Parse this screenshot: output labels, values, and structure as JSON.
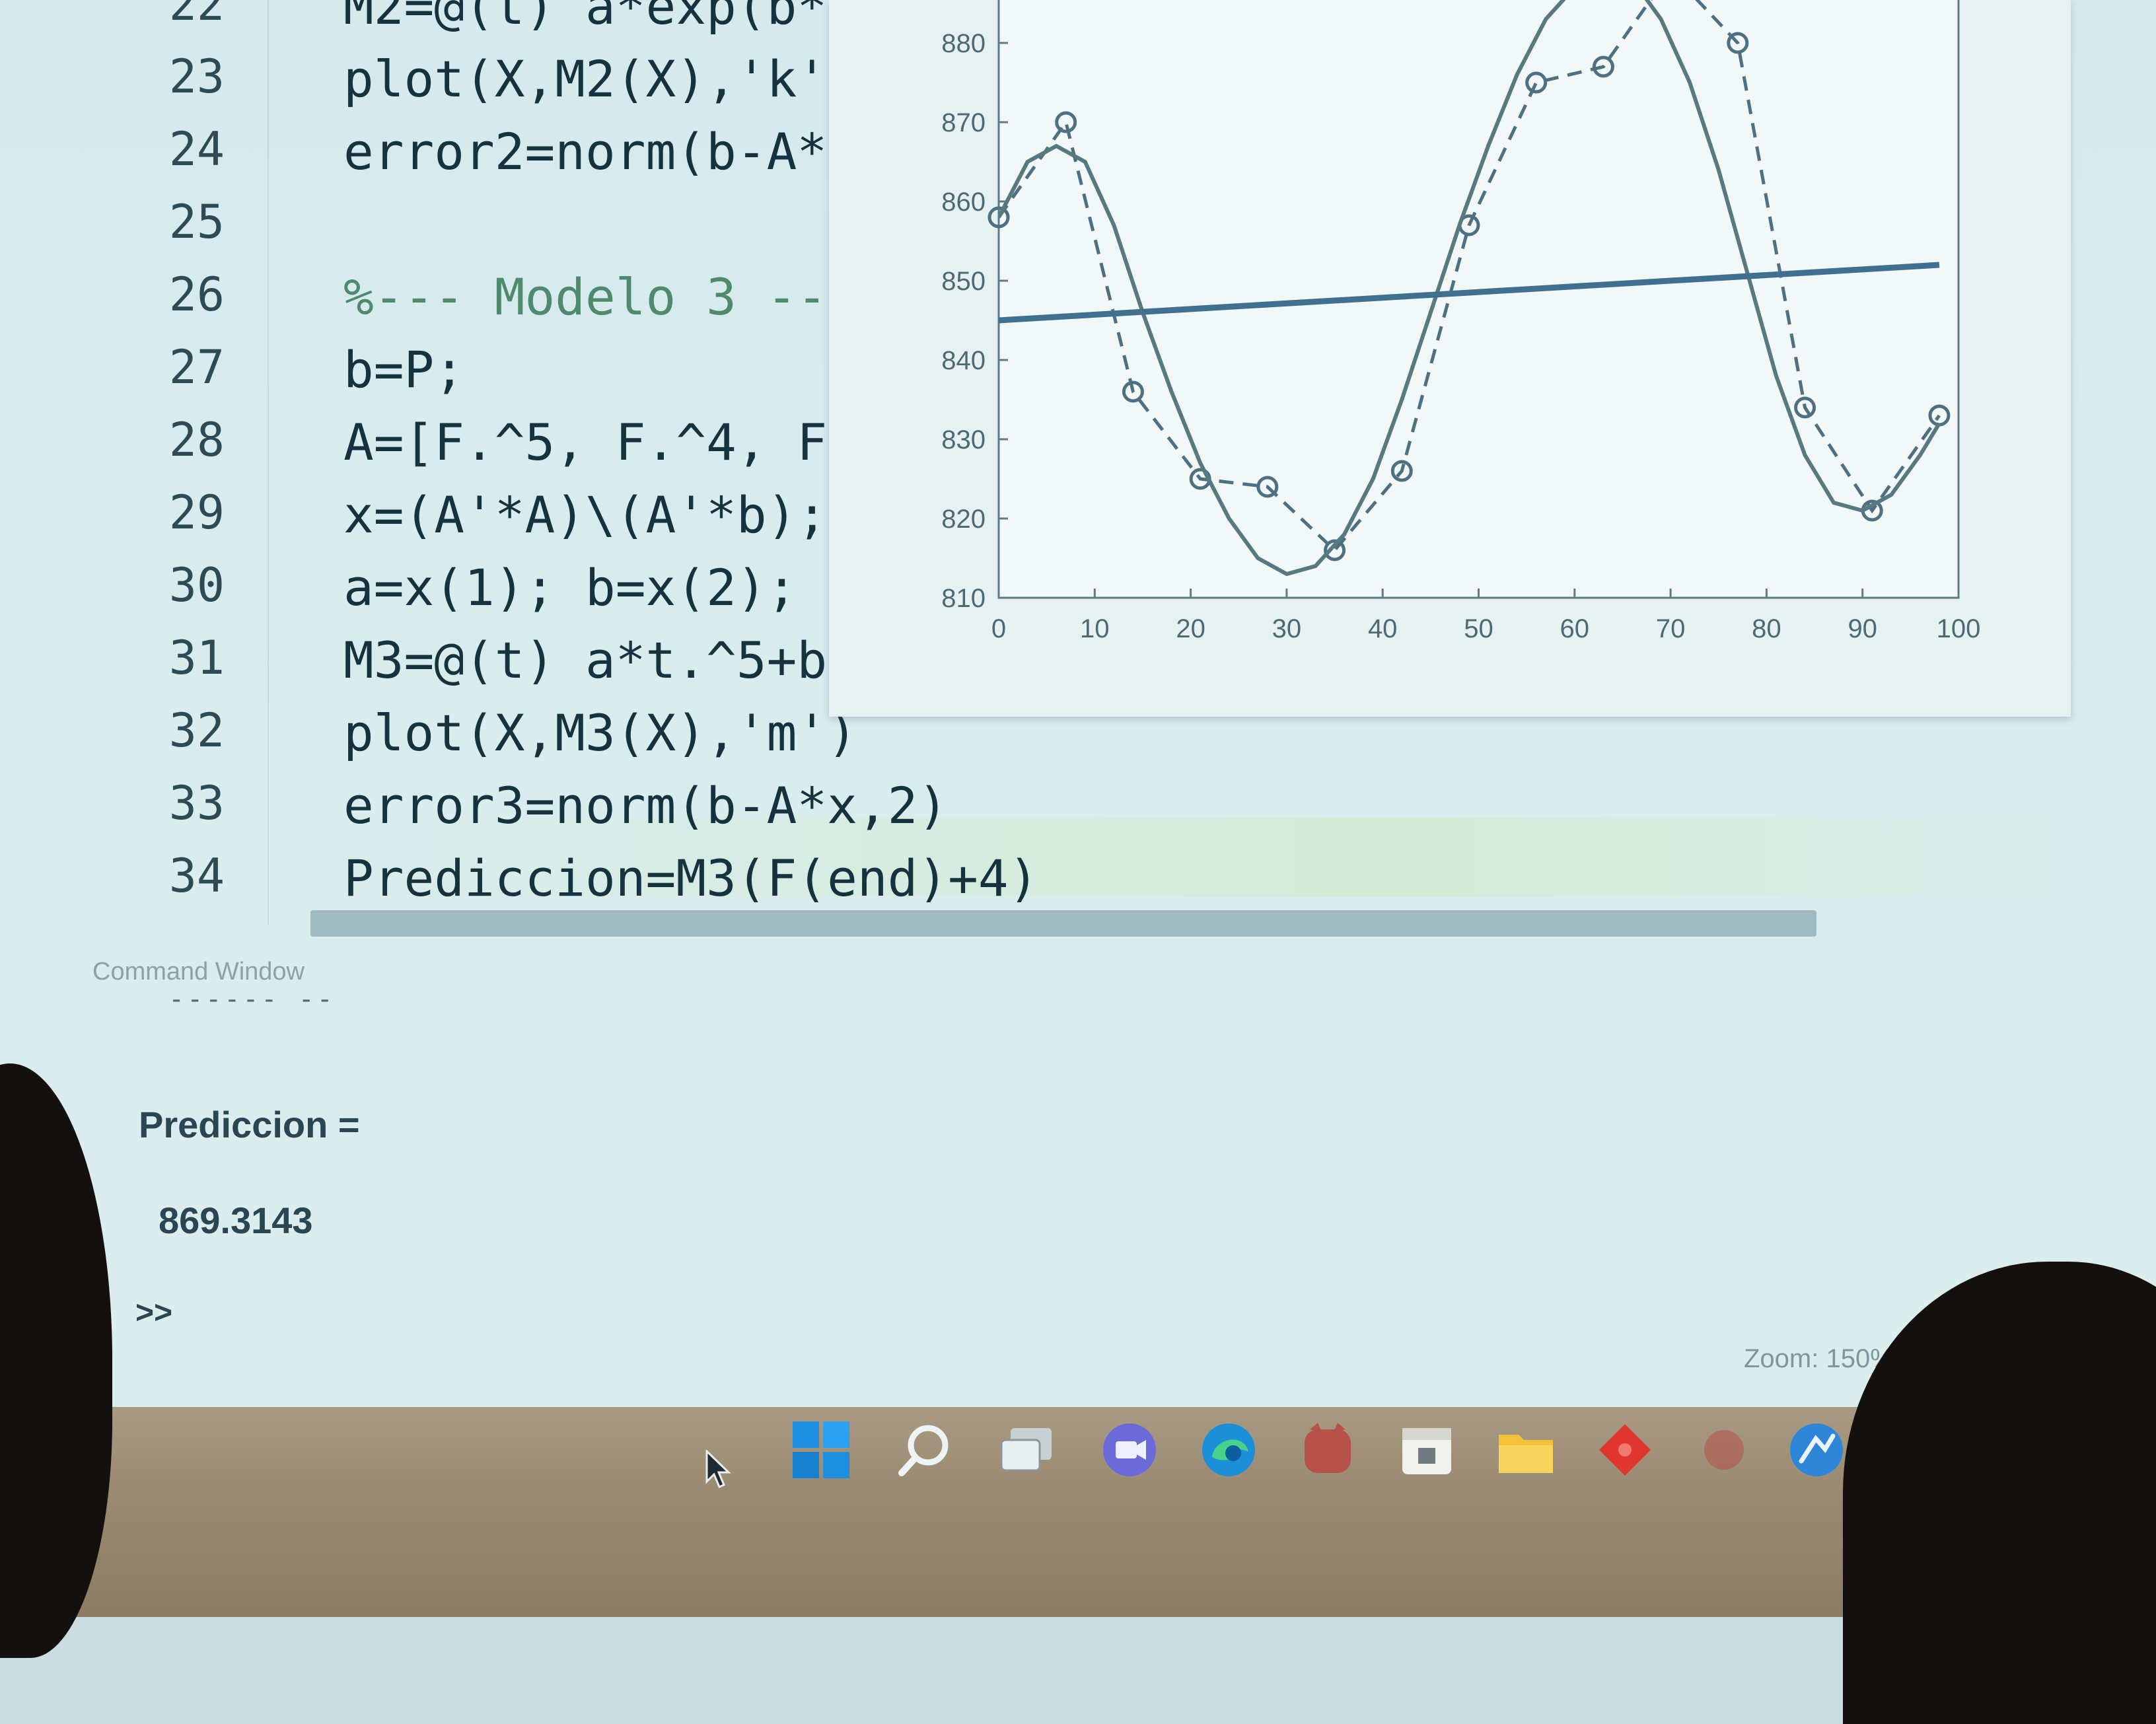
{
  "editor": {
    "lines": [
      {
        "num": "22",
        "text": "M2=@(t) a*exp(b*",
        "type": "code"
      },
      {
        "num": "23",
        "text": "plot(X,M2(X),'k'",
        "type": "code"
      },
      {
        "num": "24",
        "text": "error2=norm(b-A*",
        "type": "code"
      },
      {
        "num": "25",
        "text": "",
        "type": "code"
      },
      {
        "num": "26",
        "text": "%--- Modelo 3 --",
        "type": "comment"
      },
      {
        "num": "27",
        "text": "b=P;",
        "type": "code"
      },
      {
        "num": "28",
        "text": "A=[F.^5, F.^4, F",
        "type": "code"
      },
      {
        "num": "29",
        "text": "x=(A'*A)\\(A'*b);",
        "type": "code"
      },
      {
        "num": "30",
        "text": "a=x(1); b=x(2);",
        "type": "code"
      },
      {
        "num": "31",
        "text": "M3=@(t) a*t.^5+b",
        "type": "code"
      },
      {
        "num": "32",
        "text": "plot(X,M3(X),'m')",
        "type": "code"
      },
      {
        "num": "33",
        "text": "error3=norm(b-A*x,2)",
        "type": "code"
      },
      {
        "num": "34",
        "text": "Prediccion=M3(F(end)+4)",
        "type": "code"
      }
    ]
  },
  "command_window": {
    "label": "Command Window",
    "partial_output": "------ --",
    "variable": "Prediccion =",
    "value": "869.3143",
    "prompt": ">>"
  },
  "status": {
    "zoom": "Zoom: 150%"
  },
  "taskbar": {
    "icons": [
      "windows-start-icon",
      "search-icon",
      "task-view-icon",
      "teams-chat-icon",
      "edge-browser-icon",
      "app-icon",
      "calendar-icon",
      "file-explorer-icon",
      "red-app-icon",
      "red-app-icon-2",
      "matlab-icon"
    ]
  },
  "chart_data": {
    "type": "line",
    "xlim": [
      0,
      100
    ],
    "ylim": [
      810,
      880
    ],
    "xticks": [
      0,
      10,
      20,
      30,
      40,
      50,
      60,
      70,
      80,
      90,
      100
    ],
    "yticks": [
      810,
      820,
      830,
      840,
      850,
      860,
      870,
      880
    ],
    "grid": false,
    "series": [
      {
        "style": "dashed-with-circles",
        "color": "#4f7080",
        "x": [
          0,
          7,
          14,
          21,
          28,
          35,
          42,
          49,
          56,
          63,
          70,
          77,
          84,
          91,
          98
        ],
        "y": [
          858,
          870,
          836,
          825,
          824,
          816,
          826,
          857,
          875,
          877,
          889,
          880,
          834,
          821,
          833
        ]
      },
      {
        "style": "solid",
        "color": "#58797f",
        "x": [
          0,
          3,
          6,
          9,
          12,
          15,
          18,
          21,
          24,
          27,
          30,
          33,
          36,
          39,
          42,
          45,
          48,
          51,
          54,
          57,
          60,
          63,
          66,
          69,
          72,
          75,
          78,
          81,
          84,
          87,
          90,
          93,
          96,
          98
        ],
        "y": [
          858,
          865,
          867,
          865,
          857,
          846,
          836,
          827,
          820,
          815,
          813,
          814,
          818,
          825,
          835,
          846,
          857,
          867,
          876,
          883,
          887,
          889,
          888,
          883,
          875,
          864,
          851,
          838,
          828,
          822,
          821,
          823,
          828,
          832
        ]
      },
      {
        "style": "thick-solid",
        "color": "#3f7090",
        "x": [
          0,
          98
        ],
        "y": [
          845,
          852
        ]
      }
    ]
  }
}
